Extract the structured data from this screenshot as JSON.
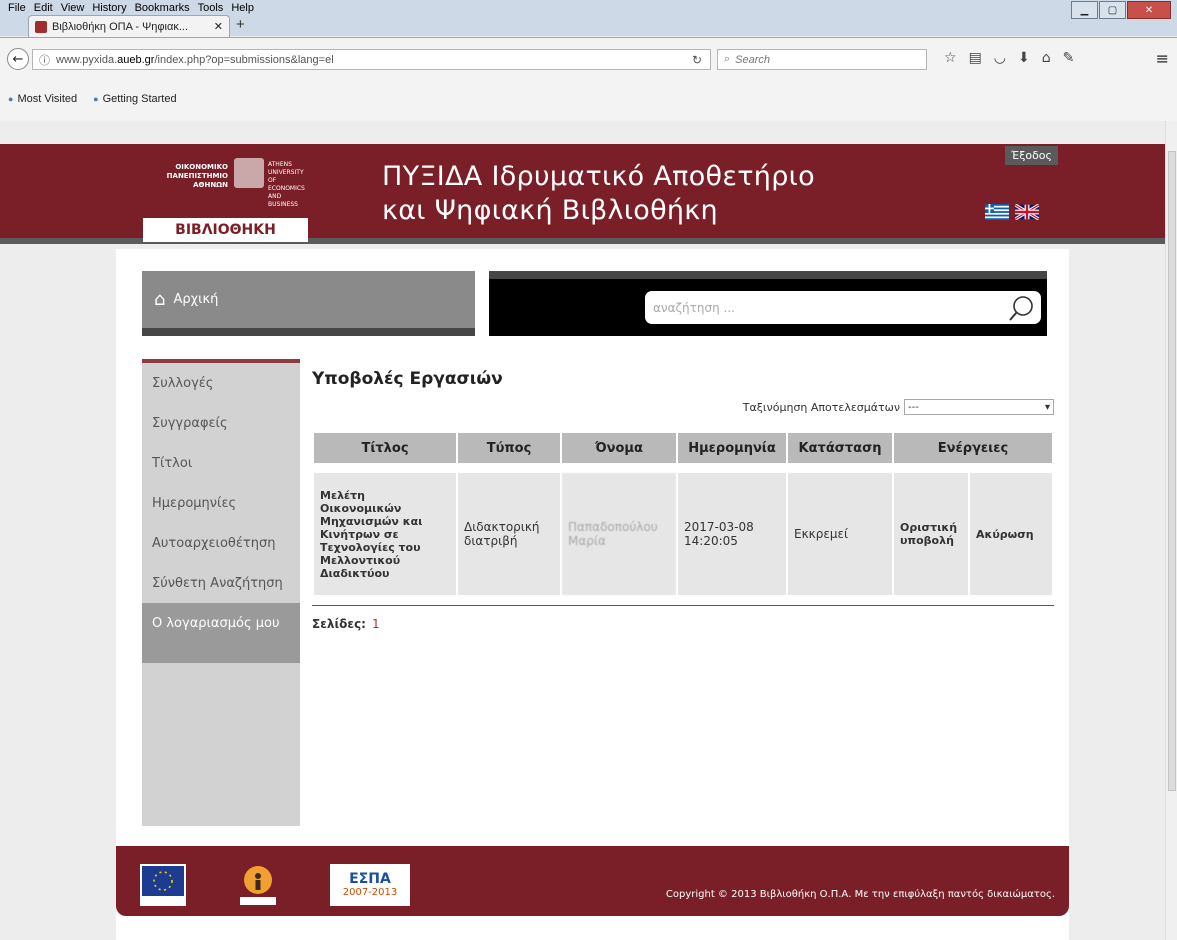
{
  "browser": {
    "menu": [
      "File",
      "Edit",
      "View",
      "History",
      "Bookmarks",
      "Tools",
      "Help"
    ],
    "tab_title": "Βιβλιοθήκη ΟΠΑ - Ψηφιακ...",
    "new_tab": "+",
    "url_prefix": "www.pyxida.",
    "url_domain": "aueb.gr",
    "url_path": "/index.php?op=submissions&lang=el",
    "search_placeholder": "Search",
    "bookmarks": [
      "Most Visited",
      "Getting Started"
    ]
  },
  "header": {
    "uni_gr": "ΟΙΚΟΝΟΜΙΚΟ ΠΑΝΕΠΙΣΤΗΜΙΟ ΑΘΗΝΩΝ",
    "uni_en": "ATHENS UNIVERSITY OF ECONOMICS AND BUSINESS",
    "library_label": "ΒΙΒΛΙΟΘΗΚΗ",
    "title_line1": "ΠΥΞΙΔΑ Ιδρυματικό Αποθετήριο",
    "title_line2": "και Ψηφιακή Βιβλιοθήκη",
    "logout": "Έξοδος"
  },
  "nav": {
    "home": "Αρχική",
    "search_placeholder": "αναζήτηση ..."
  },
  "sidebar": {
    "items": [
      {
        "label": "Συλλογές"
      },
      {
        "label": "Συγγραφείς"
      },
      {
        "label": "Τίτλοι"
      },
      {
        "label": "Ημερομηνίες"
      },
      {
        "label": "Αυτοαρχειοθέτηση"
      },
      {
        "label": "Σύνθετη Αναζήτηση"
      },
      {
        "label": "Ο λογαριασμός μου"
      }
    ]
  },
  "main": {
    "title": "Υποβολές Εργασιών",
    "sort_label": "Ταξινόμηση Αποτελεσμάτων",
    "sort_value": "---",
    "columns": [
      "Τίτλος",
      "Τύπος",
      "Όνομα",
      "Ημερομηνία",
      "Κατάσταση",
      "Ενέργειες"
    ],
    "rows": [
      {
        "title": "Μελέτη Οικονομικών Μηχανισμών και Κινήτρων σε Τεχνολογίες του Μελλοντικού Διαδικτύου",
        "type": "Διδακτορική διατριβή",
        "name": "Παπαδοπούλου Μαρία",
        "date": "2017-03-08 14:20:05",
        "status": "Εκκρεμεί",
        "action_submit": "Οριστική υποβολή",
        "action_cancel": "Ακύρωση"
      }
    ],
    "pages_label": "Σελίδες:",
    "current_page": "1"
  },
  "footer": {
    "espa_label": "ΕΣΠΑ",
    "espa_years": "2007-2013",
    "copyright": "Copyright © 2013 Βιβλιοθήκη Ο.Π.Α. Με την επιφύλαξη παντός δικαιώματος."
  },
  "colors": {
    "brand": "#7a1f28",
    "link": "#c0282e"
  }
}
